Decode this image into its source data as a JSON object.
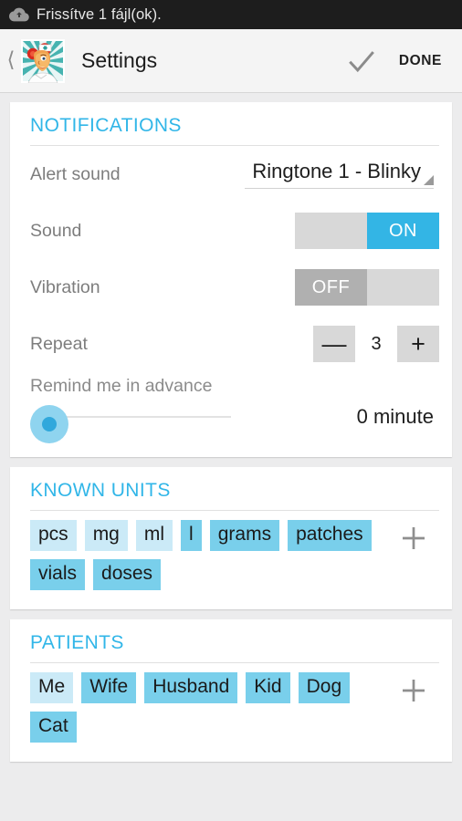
{
  "statusbar": {
    "icon": "cloud-upload-icon",
    "text": "Frissítve 1 fájl(ok)."
  },
  "actionbar": {
    "back_icon": "back-chevron-icon",
    "app_icon": "nurse-app-icon",
    "title": "Settings",
    "check_icon": "checkmark-icon",
    "done_label": "DONE"
  },
  "sections": {
    "notifications": {
      "title": "NOTIFICATIONS",
      "alert_sound": {
        "label": "Alert sound",
        "value": "Ringtone 1 - Blinky",
        "arrow_icon": "spinner-arrow-icon"
      },
      "sound": {
        "label": "Sound",
        "state": "ON"
      },
      "vibration": {
        "label": "Vibration",
        "state": "OFF"
      },
      "repeat": {
        "label": "Repeat",
        "minus": "—",
        "value": "3",
        "plus": "+"
      },
      "remind": {
        "label": "Remind me in advance",
        "value": "0 minute",
        "slider_position_percent": 0
      }
    },
    "known_units": {
      "title": "KNOWN UNITS",
      "add_icon": "plus-icon",
      "chips": [
        {
          "label": "pcs",
          "dim": true
        },
        {
          "label": "mg",
          "dim": true
        },
        {
          "label": "ml",
          "dim": true
        },
        {
          "label": "l",
          "dim": false
        },
        {
          "label": "grams",
          "dim": false
        },
        {
          "label": "patches",
          "dim": false
        },
        {
          "label": "vials",
          "dim": false
        },
        {
          "label": "doses",
          "dim": false
        }
      ]
    },
    "patients": {
      "title": "PATIENTS",
      "add_icon": "plus-icon",
      "chips": [
        {
          "label": "Me",
          "dim": true
        },
        {
          "label": "Wife",
          "dim": false
        },
        {
          "label": "Husband",
          "dim": false
        },
        {
          "label": "Kid",
          "dim": false
        },
        {
          "label": "Dog",
          "dim": false
        },
        {
          "label": "Cat",
          "dim": false
        }
      ]
    }
  },
  "colors": {
    "accent": "#31b6e8",
    "toggle_on": "#33b5e5",
    "toggle_off_thumb": "#b0b0b0",
    "chip": "#79cfeb",
    "chip_dim": "#cbeaf7",
    "statusbar_bg": "#1d1d1d",
    "page_bg": "#ececed"
  }
}
